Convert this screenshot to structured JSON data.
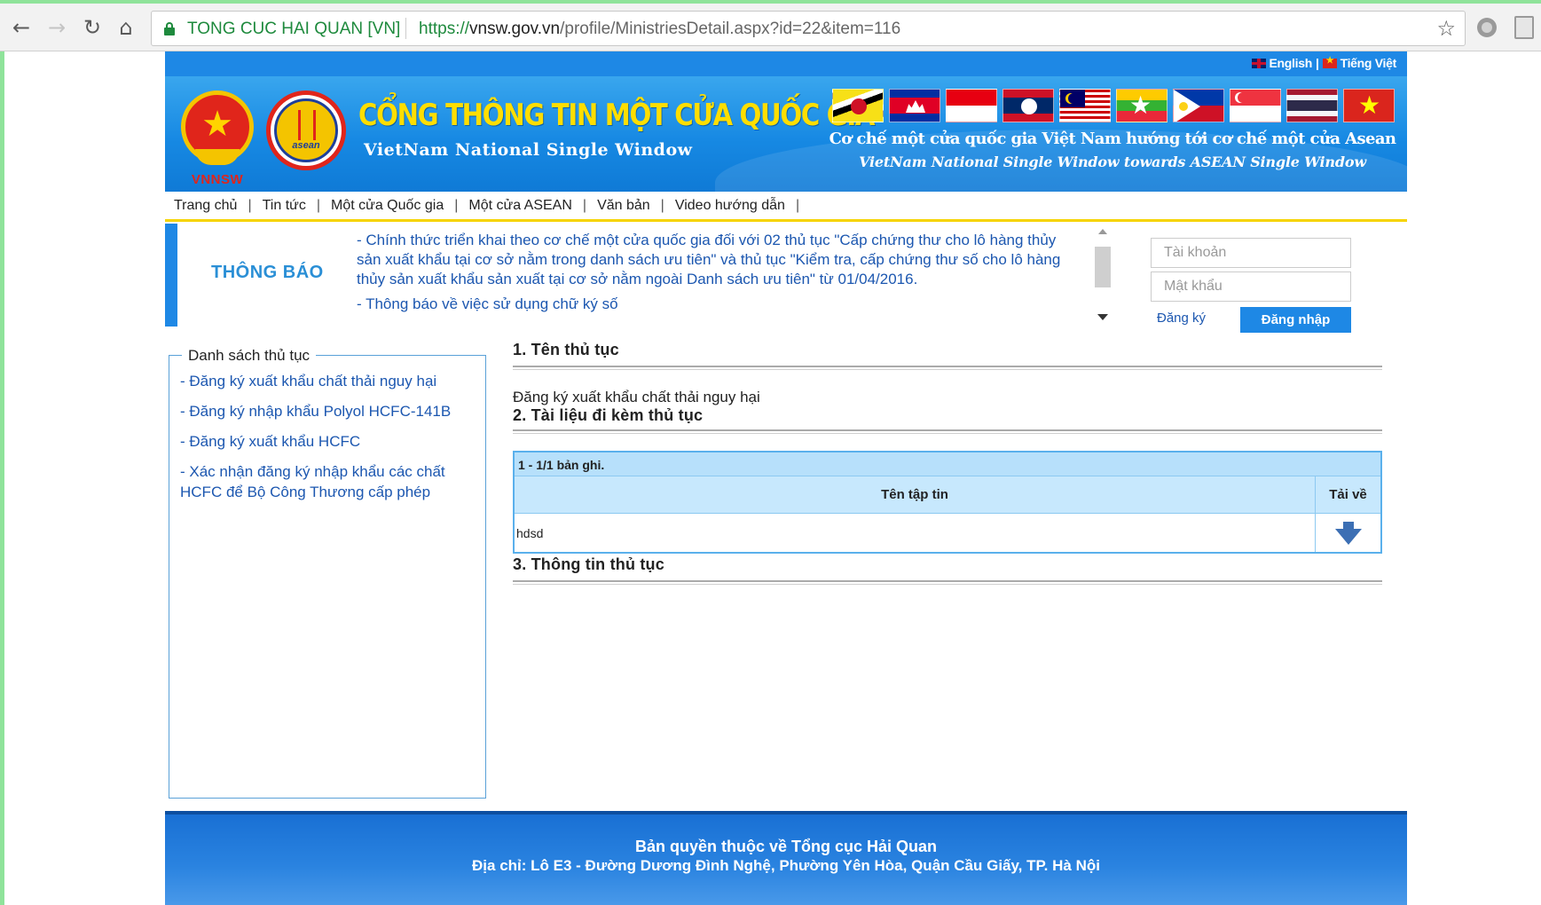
{
  "browser": {
    "site_identity": "TONG CUC HAI QUAN [VN]",
    "url_scheme": "https://",
    "url_host": "vnsw.gov.vn",
    "url_path": "/profile/MinistriesDetail.aspx?id=22&item=116"
  },
  "header": {
    "lang_english": "English",
    "lang_divider": "|",
    "lang_vietnamese": "Tiếng Việt",
    "emblem_label": "VNNSW",
    "title": "CỔNG THÔNG TIN MỘT CỬA QUỐC GIA",
    "subtitle": "VietNam National Single Window",
    "description_vi": "Cơ chế một cửa quốc gia Việt Nam hướng tới cơ chế một cửa Asean",
    "description_en": "VietNam National Single Window towards ASEAN Single Window",
    "flags": [
      "brunei-flag",
      "cambodia-flag",
      "indonesia-flag",
      "laos-flag",
      "malaysia-flag",
      "myanmar-flag",
      "philippines-flag",
      "singapore-flag",
      "thailand-flag",
      "vietnam-flag"
    ]
  },
  "menu": {
    "separator": "|",
    "items": [
      "Trang chủ",
      "Tin tức",
      "Một cửa Quốc gia",
      "Một cửa ASEAN",
      "Văn bản",
      "Video hướng dẫn"
    ]
  },
  "notice": {
    "title": "THÔNG BÁO",
    "items": [
      "- Chính thức triển khai theo cơ chế một cửa quốc gia đối với 02 thủ tục \"Cấp chứng thư cho lô hàng thủy sản xuất khẩu tại cơ sở nằm trong danh sách ưu tiên\" và thủ tục \"Kiểm tra, cấp chứng thư số cho lô hàng thủy sản xuất khẩu sản xuất tại cơ sở nằm ngoài Danh sách ưu tiên\" từ 01/04/2016.",
      "- Thông báo về việc sử dụng chữ ký số"
    ]
  },
  "login": {
    "account_placeholder": "Tài khoản",
    "password_placeholder": "Mật khẩu",
    "register_label": "Đăng ký",
    "login_label": "Đăng nhập"
  },
  "sidebar": {
    "title": "Danh sách thủ tục",
    "items": [
      "- Đăng ký xuất khẩu chất thải nguy hại",
      "- Đăng ký nhập khẩu Polyol HCFC-141B",
      "- Đăng ký xuất khẩu HCFC",
      "- Xác nhận đăng ký nhập khẩu các chất HCFC để Bộ Công Thương cấp phép"
    ]
  },
  "content": {
    "section1_title": "1. Tên thủ tục",
    "procedure_name": "Đăng ký xuất khẩu chất thải nguy hại",
    "section2_title": "2. Tài liệu đi kèm thủ tục",
    "table": {
      "caption": "1 - 1/1 bản ghi.",
      "col_filename": "Tên tập tin",
      "col_download": "Tải về",
      "rows": [
        {
          "filename": "hdsd",
          "download_icon": "download-arrow-icon"
        }
      ]
    },
    "section3_title": "3. Thông tin thủ tục"
  },
  "footer": {
    "copyright": "Bản quyền thuộc về Tổng cục Hải Quan",
    "address": "Địa chỉ: Lô E3 - Đường Dương Đình Nghệ, Phường Yên Hòa, Quận Cầu Giấy, TP. Hà Nội"
  },
  "colors": {
    "brand_blue": "#1e88e5",
    "menu_underline": "#f6d400",
    "link_blue": "#1c57b0",
    "title_yellow": "#ffde00",
    "table_header": "#c7e8fd"
  }
}
